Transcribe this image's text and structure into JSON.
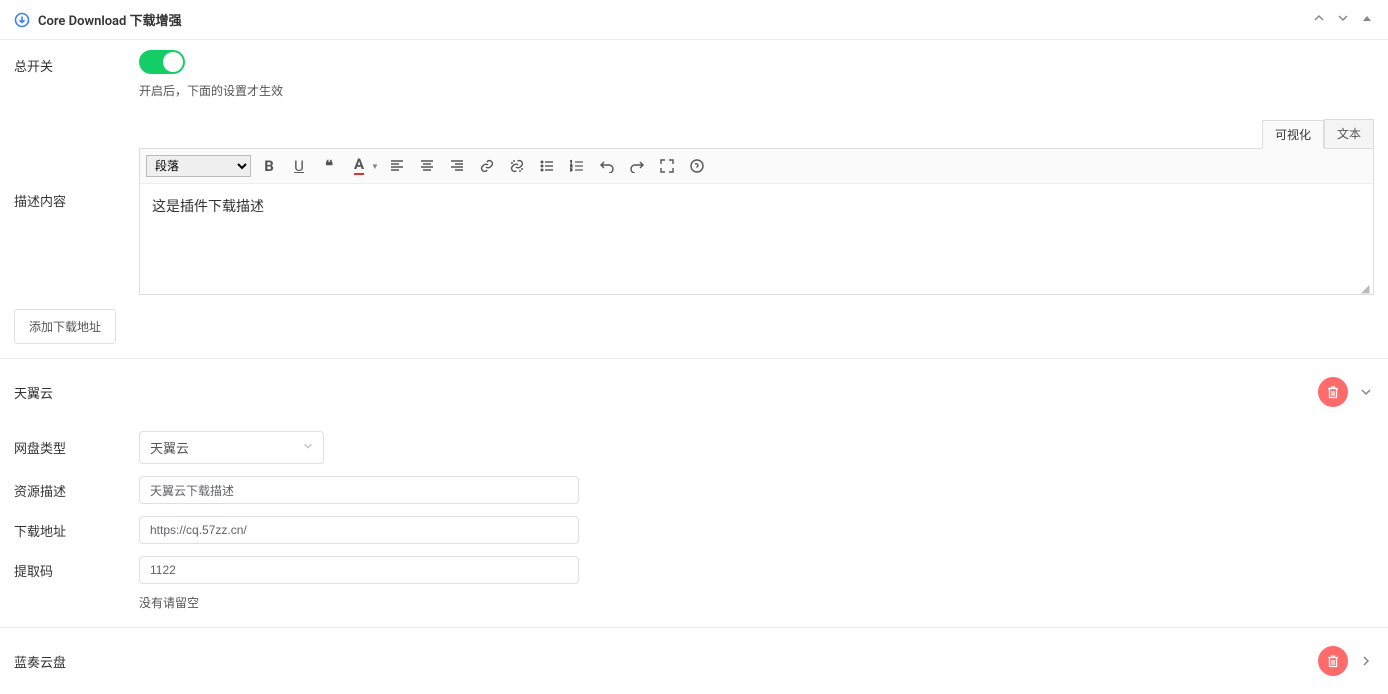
{
  "header": {
    "title": "Core Download 下载增强"
  },
  "main_switch": {
    "label": "总开关",
    "hint": "开启后，下面的设置才生效"
  },
  "editor": {
    "tabs": {
      "visual": "可视化",
      "text": "文本"
    },
    "paragraph_select": "段落",
    "content": "这是插件下载描述"
  },
  "description_label": "描述内容",
  "add_button": "添加下载地址",
  "section1": {
    "title": "天翼云",
    "type_label": "网盘类型",
    "type_value": "天翼云",
    "desc_label": "资源描述",
    "desc_value": "天翼云下载描述",
    "url_label": "下载地址",
    "url_value": "https://cq.57zz.cn/",
    "code_label": "提取码",
    "code_value": "1122",
    "code_hint": "没有请留空"
  },
  "section2": {
    "title": "蓝奏云盘"
  }
}
